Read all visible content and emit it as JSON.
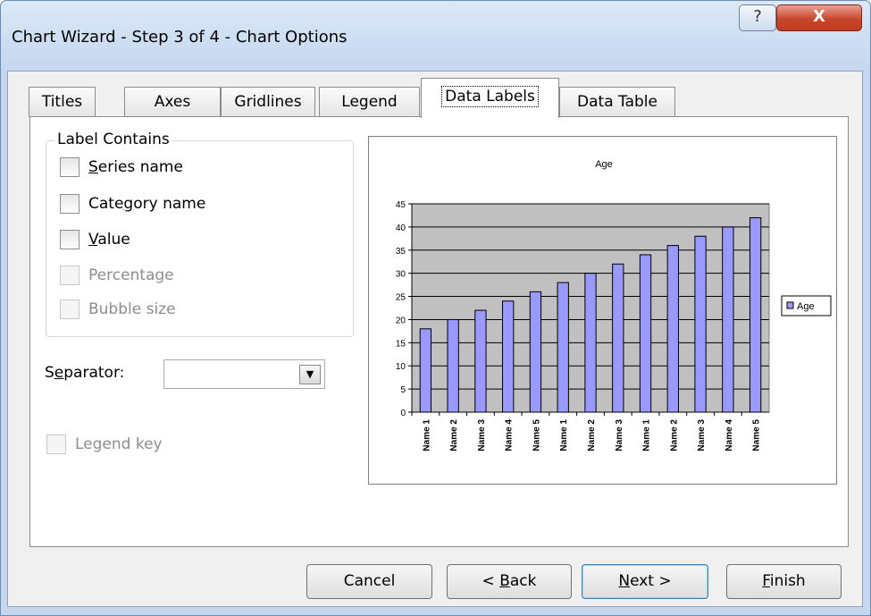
{
  "window": {
    "title": "Chart Wizard - Step 3 of 4 - Chart Options"
  },
  "titlebar_buttons": {
    "help": "?",
    "close": "X"
  },
  "tabs": [
    {
      "label": "Titles",
      "active": false
    },
    {
      "label": "Axes",
      "active": false
    },
    {
      "label": "Gridlines",
      "active": false
    },
    {
      "label": "Legend",
      "active": false
    },
    {
      "label": "Data Labels",
      "active": true
    },
    {
      "label": "Data Table",
      "active": false
    }
  ],
  "label_contains": {
    "legend": "Label Contains",
    "options": [
      {
        "label": "Series name",
        "checked": false,
        "enabled": true,
        "access_key": "S"
      },
      {
        "label": "Category name",
        "checked": false,
        "enabled": true,
        "access_key": "g"
      },
      {
        "label": "Value",
        "checked": false,
        "enabled": true,
        "access_key": "V"
      },
      {
        "label": "Percentage",
        "checked": false,
        "enabled": false
      },
      {
        "label": "Bubble size",
        "checked": false,
        "enabled": false
      }
    ]
  },
  "separator": {
    "label": "Separator:",
    "value": ""
  },
  "legend_key": {
    "label": "Legend key",
    "checked": false,
    "enabled": false
  },
  "buttons": {
    "cancel": "Cancel",
    "back": "< Back",
    "next": "Next >",
    "finish": "Finish"
  },
  "colors": {
    "bar_fill": "#9999ff",
    "plot_area": "#c0c0c0"
  },
  "chart_data": {
    "type": "bar",
    "title": "Age",
    "categories": [
      "Name 1",
      "Name 2",
      "Name 3",
      "Name 4",
      "Name 5",
      "Name 1",
      "Name 2",
      "Name 3",
      "Name 1",
      "Name 2",
      "Name 3",
      "Name 4",
      "Name 5"
    ],
    "series": [
      {
        "name": "Age",
        "values": [
          18,
          20,
          22,
          24,
          26,
          28,
          30,
          32,
          34,
          36,
          38,
          40,
          42
        ]
      }
    ],
    "ylim": [
      0,
      45
    ],
    "yticks": [
      0,
      5,
      10,
      15,
      20,
      25,
      30,
      35,
      40,
      45
    ],
    "legend": "right",
    "grid": true
  }
}
